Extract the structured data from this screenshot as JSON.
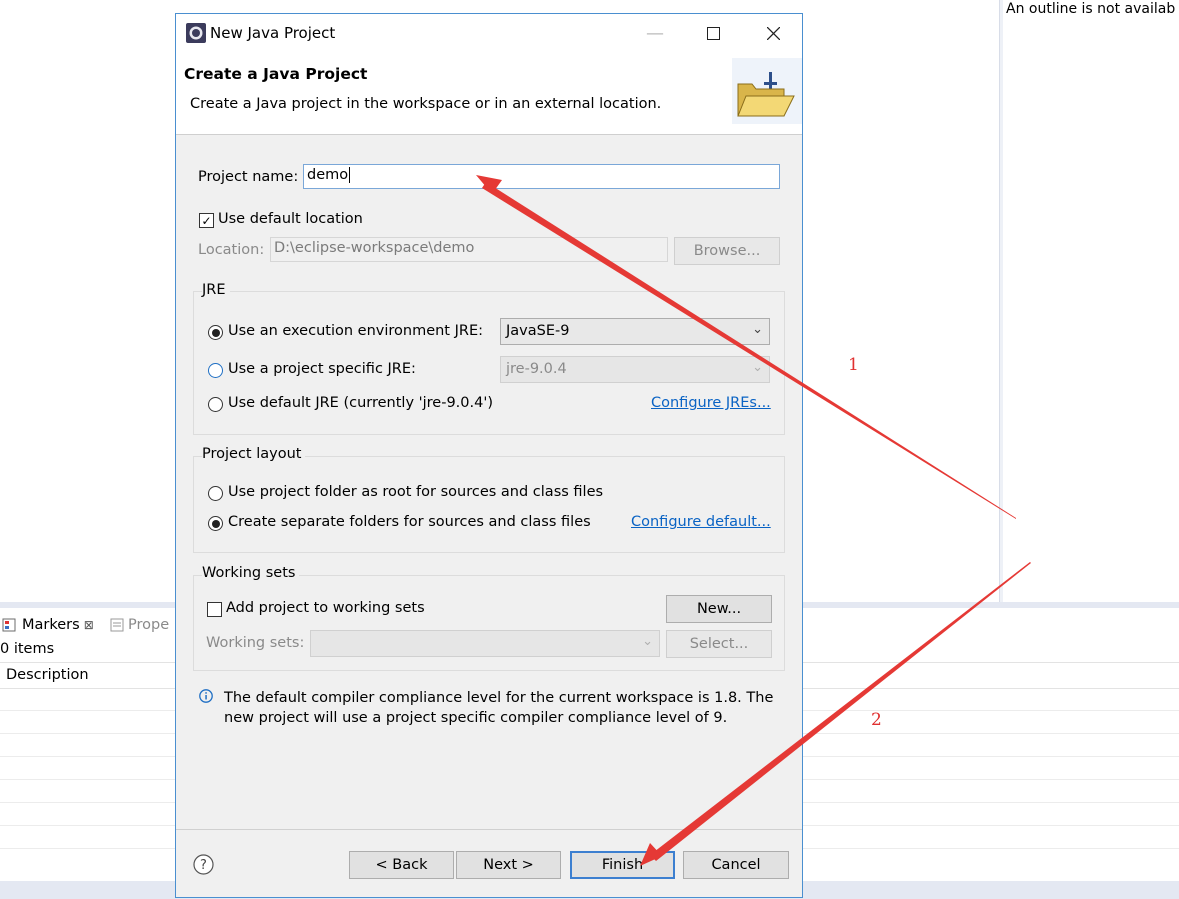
{
  "background": {
    "outline_message": "An outline is not availab",
    "markers_tab": "Markers",
    "markers_tab_close": "⊠",
    "properties_tab": "Prope",
    "items_count": "0 items",
    "description_header": "Description"
  },
  "dialog": {
    "window_title": "New Java Project",
    "banner_title": "Create a Java Project",
    "banner_subtitle": "Create a Java project in the workspace or in an external location.",
    "project_name_label": "Project name:",
    "project_name_value": "demo",
    "use_default_location_label": "Use default location",
    "use_default_location_checked": true,
    "location_label": "Location:",
    "location_value": "D:\\eclipse-workspace\\demo",
    "browse_button": "Browse...",
    "jre": {
      "group_title": "JRE",
      "option_execution_env": "Use an execution environment JRE:",
      "execution_env_value": "JavaSE-9",
      "option_project_specific": "Use a project specific JRE:",
      "project_specific_value": "jre-9.0.4",
      "option_default": "Use default JRE (currently 'jre-9.0.4')",
      "configure_link": "Configure JREs...",
      "selected": "execution_env"
    },
    "layout": {
      "group_title": "Project layout",
      "option_root": "Use project folder as root for sources and class files",
      "option_separate": "Create separate folders for sources and class files",
      "configure_link": "Configure default...",
      "selected": "separate"
    },
    "working_sets": {
      "group_title": "Working sets",
      "add_label": "Add project to working sets",
      "add_checked": false,
      "new_button": "New...",
      "sets_label": "Working sets:",
      "select_button": "Select..."
    },
    "info_message": "The default compiler compliance level for the current workspace is 1.8. The new project will use a project specific compiler compliance level of 9.",
    "buttons": {
      "back": "< Back",
      "next": "Next >",
      "finish": "Finish",
      "cancel": "Cancel"
    }
  },
  "annotations": {
    "label_1": "1",
    "label_2": "2",
    "arrow_color": "#e53935"
  },
  "colors": {
    "accent": "#3c7fd0",
    "link": "#0a63c4",
    "dialog_bg": "#f0f0f0"
  }
}
